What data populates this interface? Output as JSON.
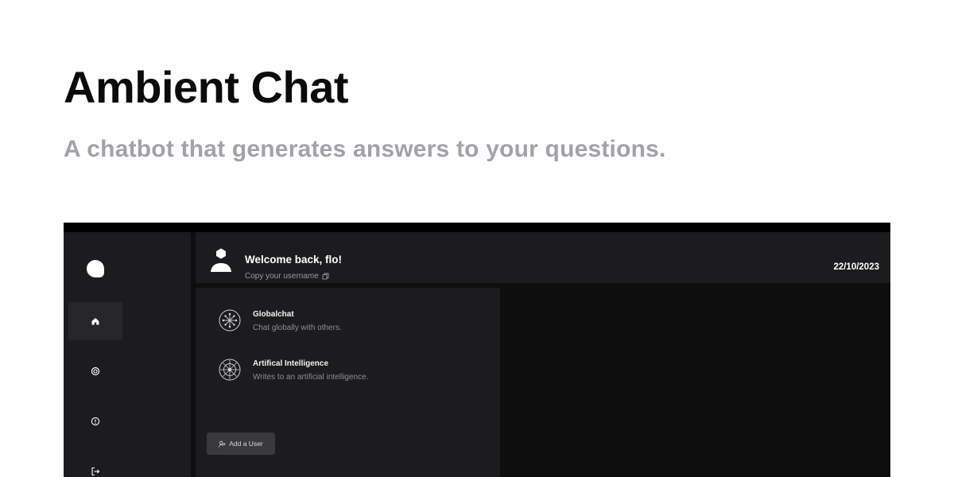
{
  "hero": {
    "title": "Ambient Chat",
    "subtitle": "A chatbot that generates answers to your questions."
  },
  "app": {
    "rail": {
      "logo_icon": "chat-bubble-icon",
      "items": [
        {
          "icon": "home-icon",
          "active": true
        },
        {
          "icon": "settings-icon",
          "active": false
        },
        {
          "icon": "info-icon",
          "active": false
        },
        {
          "icon": "logout-icon",
          "active": false
        }
      ]
    },
    "header": {
      "welcome": "Welcome back, flo!",
      "copy_username": "Copy your username",
      "date": "22/10/2023"
    },
    "chats": [
      {
        "name": "Globalchat",
        "description": "Chat globally with others.",
        "icon": "globe-network-icon"
      },
      {
        "name": "Artifical Intelligence",
        "description": "Writes to an artificial intelligence.",
        "icon": "ai-network-icon"
      }
    ],
    "add_user_label": "Add a User",
    "colors": {
      "background": "#0e0e0f",
      "panel": "#1c1c1e",
      "active_item": "#262628",
      "button": "#3a3a3c",
      "subtitle": "#a2a2a8"
    }
  }
}
